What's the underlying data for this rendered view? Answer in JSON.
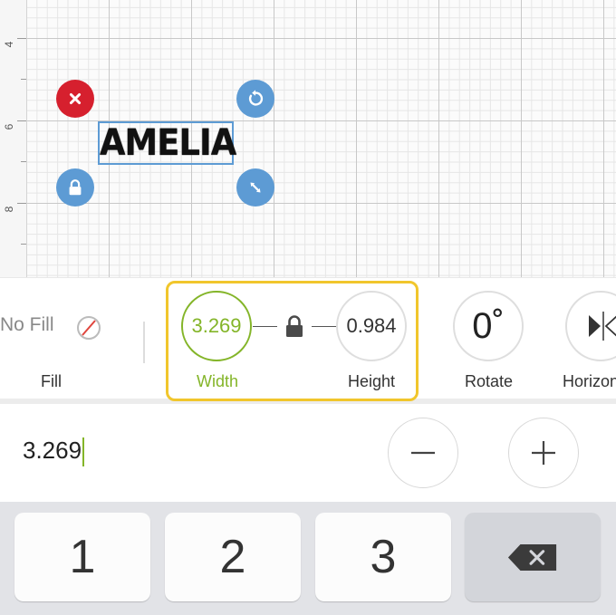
{
  "canvas": {
    "ruler_marks": [
      "4",
      "6",
      "8"
    ],
    "object_text": "AMELIA"
  },
  "toolbar": {
    "fill_value": "No Fill",
    "fill_label": "Fill",
    "width_value": "3.269",
    "width_label": "Width",
    "height_value": "0.984",
    "height_label": "Height",
    "rotate_value": "0˚",
    "rotate_label": "Rotate",
    "flip_label": "Horizon"
  },
  "input": {
    "value": "3.269"
  },
  "keypad": {
    "keys": [
      "1",
      "2",
      "3"
    ]
  },
  "colors": {
    "accent_green": "#84b529",
    "highlight_yellow": "#f1c62c",
    "handle_blue": "#5d9bd4",
    "handle_red": "#d6202e"
  }
}
